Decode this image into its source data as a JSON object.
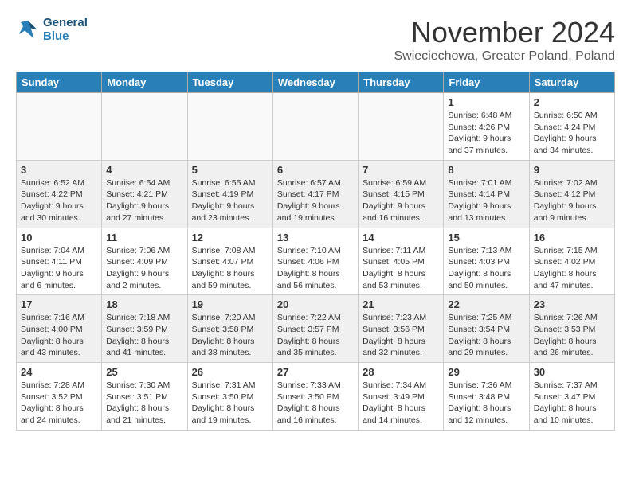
{
  "header": {
    "logo_line1": "General",
    "logo_line2": "Blue",
    "month_title": "November 2024",
    "subtitle": "Swieciechowa, Greater Poland, Poland"
  },
  "weekdays": [
    "Sunday",
    "Monday",
    "Tuesday",
    "Wednesday",
    "Thursday",
    "Friday",
    "Saturday"
  ],
  "weeks": [
    [
      {
        "day": "",
        "info": ""
      },
      {
        "day": "",
        "info": ""
      },
      {
        "day": "",
        "info": ""
      },
      {
        "day": "",
        "info": ""
      },
      {
        "day": "",
        "info": ""
      },
      {
        "day": "1",
        "info": "Sunrise: 6:48 AM\nSunset: 4:26 PM\nDaylight: 9 hours\nand 37 minutes."
      },
      {
        "day": "2",
        "info": "Sunrise: 6:50 AM\nSunset: 4:24 PM\nDaylight: 9 hours\nand 34 minutes."
      }
    ],
    [
      {
        "day": "3",
        "info": "Sunrise: 6:52 AM\nSunset: 4:22 PM\nDaylight: 9 hours\nand 30 minutes."
      },
      {
        "day": "4",
        "info": "Sunrise: 6:54 AM\nSunset: 4:21 PM\nDaylight: 9 hours\nand 27 minutes."
      },
      {
        "day": "5",
        "info": "Sunrise: 6:55 AM\nSunset: 4:19 PM\nDaylight: 9 hours\nand 23 minutes."
      },
      {
        "day": "6",
        "info": "Sunrise: 6:57 AM\nSunset: 4:17 PM\nDaylight: 9 hours\nand 19 minutes."
      },
      {
        "day": "7",
        "info": "Sunrise: 6:59 AM\nSunset: 4:15 PM\nDaylight: 9 hours\nand 16 minutes."
      },
      {
        "day": "8",
        "info": "Sunrise: 7:01 AM\nSunset: 4:14 PM\nDaylight: 9 hours\nand 13 minutes."
      },
      {
        "day": "9",
        "info": "Sunrise: 7:02 AM\nSunset: 4:12 PM\nDaylight: 9 hours\nand 9 minutes."
      }
    ],
    [
      {
        "day": "10",
        "info": "Sunrise: 7:04 AM\nSunset: 4:11 PM\nDaylight: 9 hours\nand 6 minutes."
      },
      {
        "day": "11",
        "info": "Sunrise: 7:06 AM\nSunset: 4:09 PM\nDaylight: 9 hours\nand 2 minutes."
      },
      {
        "day": "12",
        "info": "Sunrise: 7:08 AM\nSunset: 4:07 PM\nDaylight: 8 hours\nand 59 minutes."
      },
      {
        "day": "13",
        "info": "Sunrise: 7:10 AM\nSunset: 4:06 PM\nDaylight: 8 hours\nand 56 minutes."
      },
      {
        "day": "14",
        "info": "Sunrise: 7:11 AM\nSunset: 4:05 PM\nDaylight: 8 hours\nand 53 minutes."
      },
      {
        "day": "15",
        "info": "Sunrise: 7:13 AM\nSunset: 4:03 PM\nDaylight: 8 hours\nand 50 minutes."
      },
      {
        "day": "16",
        "info": "Sunrise: 7:15 AM\nSunset: 4:02 PM\nDaylight: 8 hours\nand 47 minutes."
      }
    ],
    [
      {
        "day": "17",
        "info": "Sunrise: 7:16 AM\nSunset: 4:00 PM\nDaylight: 8 hours\nand 43 minutes."
      },
      {
        "day": "18",
        "info": "Sunrise: 7:18 AM\nSunset: 3:59 PM\nDaylight: 8 hours\nand 41 minutes."
      },
      {
        "day": "19",
        "info": "Sunrise: 7:20 AM\nSunset: 3:58 PM\nDaylight: 8 hours\nand 38 minutes."
      },
      {
        "day": "20",
        "info": "Sunrise: 7:22 AM\nSunset: 3:57 PM\nDaylight: 8 hours\nand 35 minutes."
      },
      {
        "day": "21",
        "info": "Sunrise: 7:23 AM\nSunset: 3:56 PM\nDaylight: 8 hours\nand 32 minutes."
      },
      {
        "day": "22",
        "info": "Sunrise: 7:25 AM\nSunset: 3:54 PM\nDaylight: 8 hours\nand 29 minutes."
      },
      {
        "day": "23",
        "info": "Sunrise: 7:26 AM\nSunset: 3:53 PM\nDaylight: 8 hours\nand 26 minutes."
      }
    ],
    [
      {
        "day": "24",
        "info": "Sunrise: 7:28 AM\nSunset: 3:52 PM\nDaylight: 8 hours\nand 24 minutes."
      },
      {
        "day": "25",
        "info": "Sunrise: 7:30 AM\nSunset: 3:51 PM\nDaylight: 8 hours\nand 21 minutes."
      },
      {
        "day": "26",
        "info": "Sunrise: 7:31 AM\nSunset: 3:50 PM\nDaylight: 8 hours\nand 19 minutes."
      },
      {
        "day": "27",
        "info": "Sunrise: 7:33 AM\nSunset: 3:50 PM\nDaylight: 8 hours\nand 16 minutes."
      },
      {
        "day": "28",
        "info": "Sunrise: 7:34 AM\nSunset: 3:49 PM\nDaylight: 8 hours\nand 14 minutes."
      },
      {
        "day": "29",
        "info": "Sunrise: 7:36 AM\nSunset: 3:48 PM\nDaylight: 8 hours\nand 12 minutes."
      },
      {
        "day": "30",
        "info": "Sunrise: 7:37 AM\nSunset: 3:47 PM\nDaylight: 8 hours\nand 10 minutes."
      }
    ]
  ]
}
